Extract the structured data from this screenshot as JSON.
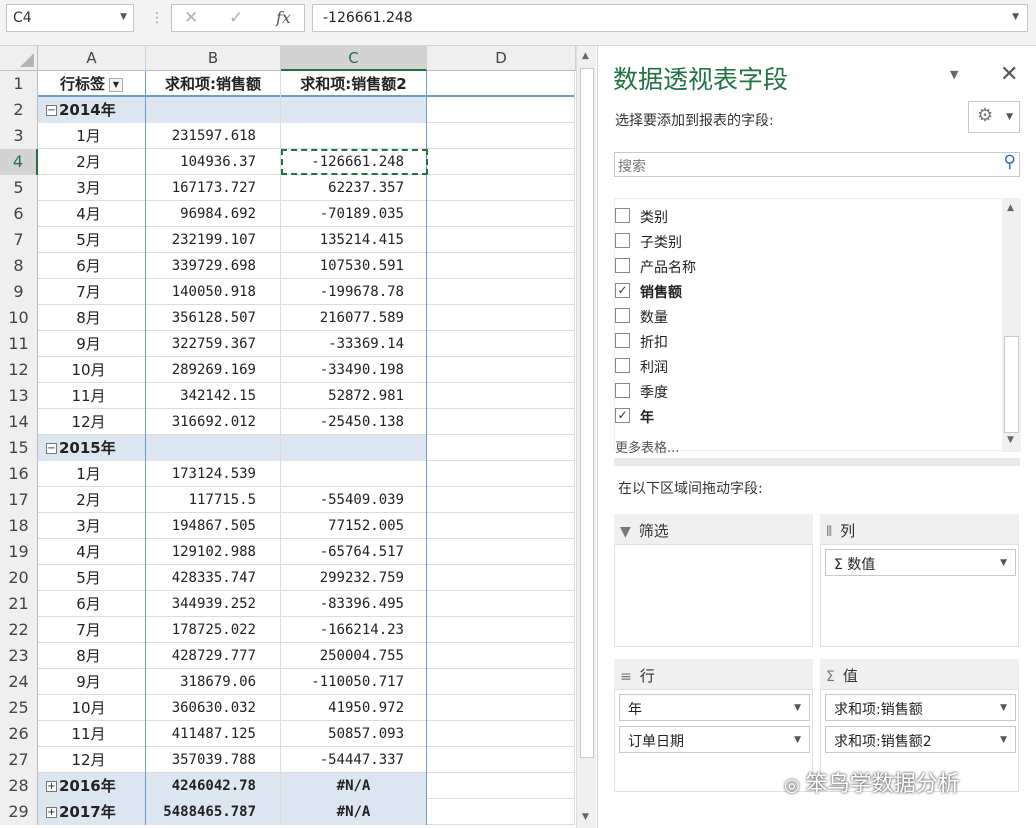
{
  "formula_bar": {
    "name_box": "C4",
    "cancel_icon": "✕",
    "enter_icon": "✓",
    "fx_label": "fx",
    "formula": "-126661.248"
  },
  "columns": [
    "A",
    "B",
    "C",
    "D"
  ],
  "pivot": {
    "headers": {
      "a": "行标签",
      "b": "求和项:销售额",
      "c": "求和项:销售额2"
    },
    "rows": [
      {
        "n": "1",
        "type": "hdr"
      },
      {
        "n": "2",
        "type": "year",
        "a": "2014年",
        "sign": "−",
        "b": "",
        "c": ""
      },
      {
        "n": "3",
        "type": "month",
        "a": "1月",
        "b": "231597.618",
        "c": ""
      },
      {
        "n": "4",
        "type": "month",
        "a": "2月",
        "b": "104936.37",
        "c": "-126661.248"
      },
      {
        "n": "5",
        "type": "month",
        "a": "3月",
        "b": "167173.727",
        "c": "62237.357"
      },
      {
        "n": "6",
        "type": "month",
        "a": "4月",
        "b": "96984.692",
        "c": "-70189.035"
      },
      {
        "n": "7",
        "type": "month",
        "a": "5月",
        "b": "232199.107",
        "c": "135214.415"
      },
      {
        "n": "8",
        "type": "month",
        "a": "6月",
        "b": "339729.698",
        "c": "107530.591"
      },
      {
        "n": "9",
        "type": "month",
        "a": "7月",
        "b": "140050.918",
        "c": "-199678.78"
      },
      {
        "n": "10",
        "type": "month",
        "a": "8月",
        "b": "356128.507",
        "c": "216077.589"
      },
      {
        "n": "11",
        "type": "month",
        "a": "9月",
        "b": "322759.367",
        "c": "-33369.14"
      },
      {
        "n": "12",
        "type": "month",
        "a": "10月",
        "b": "289269.169",
        "c": "-33490.198"
      },
      {
        "n": "13",
        "type": "month",
        "a": "11月",
        "b": "342142.15",
        "c": "52872.981"
      },
      {
        "n": "14",
        "type": "month",
        "a": "12月",
        "b": "316692.012",
        "c": "-25450.138"
      },
      {
        "n": "15",
        "type": "year",
        "a": "2015年",
        "sign": "−",
        "b": "",
        "c": ""
      },
      {
        "n": "16",
        "type": "month",
        "a": "1月",
        "b": "173124.539",
        "c": ""
      },
      {
        "n": "17",
        "type": "month",
        "a": "2月",
        "b": "117715.5",
        "c": "-55409.039"
      },
      {
        "n": "18",
        "type": "month",
        "a": "3月",
        "b": "194867.505",
        "c": "77152.005"
      },
      {
        "n": "19",
        "type": "month",
        "a": "4月",
        "b": "129102.988",
        "c": "-65764.517"
      },
      {
        "n": "20",
        "type": "month",
        "a": "5月",
        "b": "428335.747",
        "c": "299232.759"
      },
      {
        "n": "21",
        "type": "month",
        "a": "6月",
        "b": "344939.252",
        "c": "-83396.495"
      },
      {
        "n": "22",
        "type": "month",
        "a": "7月",
        "b": "178725.022",
        "c": "-166214.23"
      },
      {
        "n": "23",
        "type": "month",
        "a": "8月",
        "b": "428729.777",
        "c": "250004.755"
      },
      {
        "n": "24",
        "type": "month",
        "a": "9月",
        "b": "318679.06",
        "c": "-110050.717"
      },
      {
        "n": "25",
        "type": "month",
        "a": "10月",
        "b": "360630.032",
        "c": "41950.972"
      },
      {
        "n": "26",
        "type": "month",
        "a": "11月",
        "b": "411487.125",
        "c": "50857.093"
      },
      {
        "n": "27",
        "type": "month",
        "a": "12月",
        "b": "357039.788",
        "c": "-54447.337"
      },
      {
        "n": "28",
        "type": "year",
        "a": "2016年",
        "sign": "+",
        "b": "4246042.78",
        "c": "#N/A"
      },
      {
        "n": "29",
        "type": "year",
        "a": "2017年",
        "sign": "+",
        "b": "5488465.787",
        "c": "#N/A"
      }
    ]
  },
  "pane": {
    "title": "数据透视表字段",
    "subtitle": "选择要添加到报表的字段:",
    "search_placeholder": "搜索",
    "fields": [
      {
        "label": "类别",
        "checked": false
      },
      {
        "label": "子类别",
        "checked": false
      },
      {
        "label": "产品名称",
        "checked": false
      },
      {
        "label": "销售额",
        "checked": true
      },
      {
        "label": "数量",
        "checked": false
      },
      {
        "label": "折扣",
        "checked": false
      },
      {
        "label": "利润",
        "checked": false
      },
      {
        "label": "季度",
        "checked": false
      },
      {
        "label": "年",
        "checked": true
      }
    ],
    "more_tables": "更多表格...",
    "drag_label": "在以下区域间拖动字段:",
    "areas": {
      "filter": {
        "label": "筛选",
        "icon": "filter-icon"
      },
      "columns": {
        "label": "列",
        "icon": "columns-icon",
        "items": [
          "Σ 数值"
        ]
      },
      "rows": {
        "label": "行",
        "icon": "rows-icon",
        "items": [
          "年",
          "订单日期"
        ]
      },
      "values": {
        "label": "值",
        "icon": "sigma-icon",
        "items": [
          "求和项:销售额",
          "求和项:销售额2"
        ]
      }
    }
  },
  "watermark": "笨鸟学数据分析",
  "colors": {
    "accent": "#217346",
    "year_band": "#dce6f1",
    "header_border": "#6e9bc8"
  }
}
